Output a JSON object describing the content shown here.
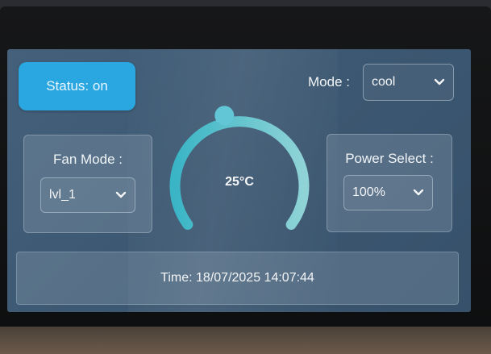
{
  "status": {
    "label": "Status: on"
  },
  "mode": {
    "label": "Mode :",
    "value": "cool"
  },
  "fan": {
    "label": "Fan Mode :",
    "value": "lvl_1"
  },
  "power": {
    "label": "Power Select :",
    "value": "100%"
  },
  "temperature": {
    "display": "25°C",
    "arc_fraction": 0.45
  },
  "time": {
    "text": "Time: 18/07/2025 14:07:44"
  },
  "colors": {
    "accent": "#2aa6e0",
    "arc_start": "#3ab5c6",
    "arc_end": "#8fd3d6",
    "knob": "#63c6d6"
  },
  "icons": [
    "chevron-down-icon"
  ]
}
